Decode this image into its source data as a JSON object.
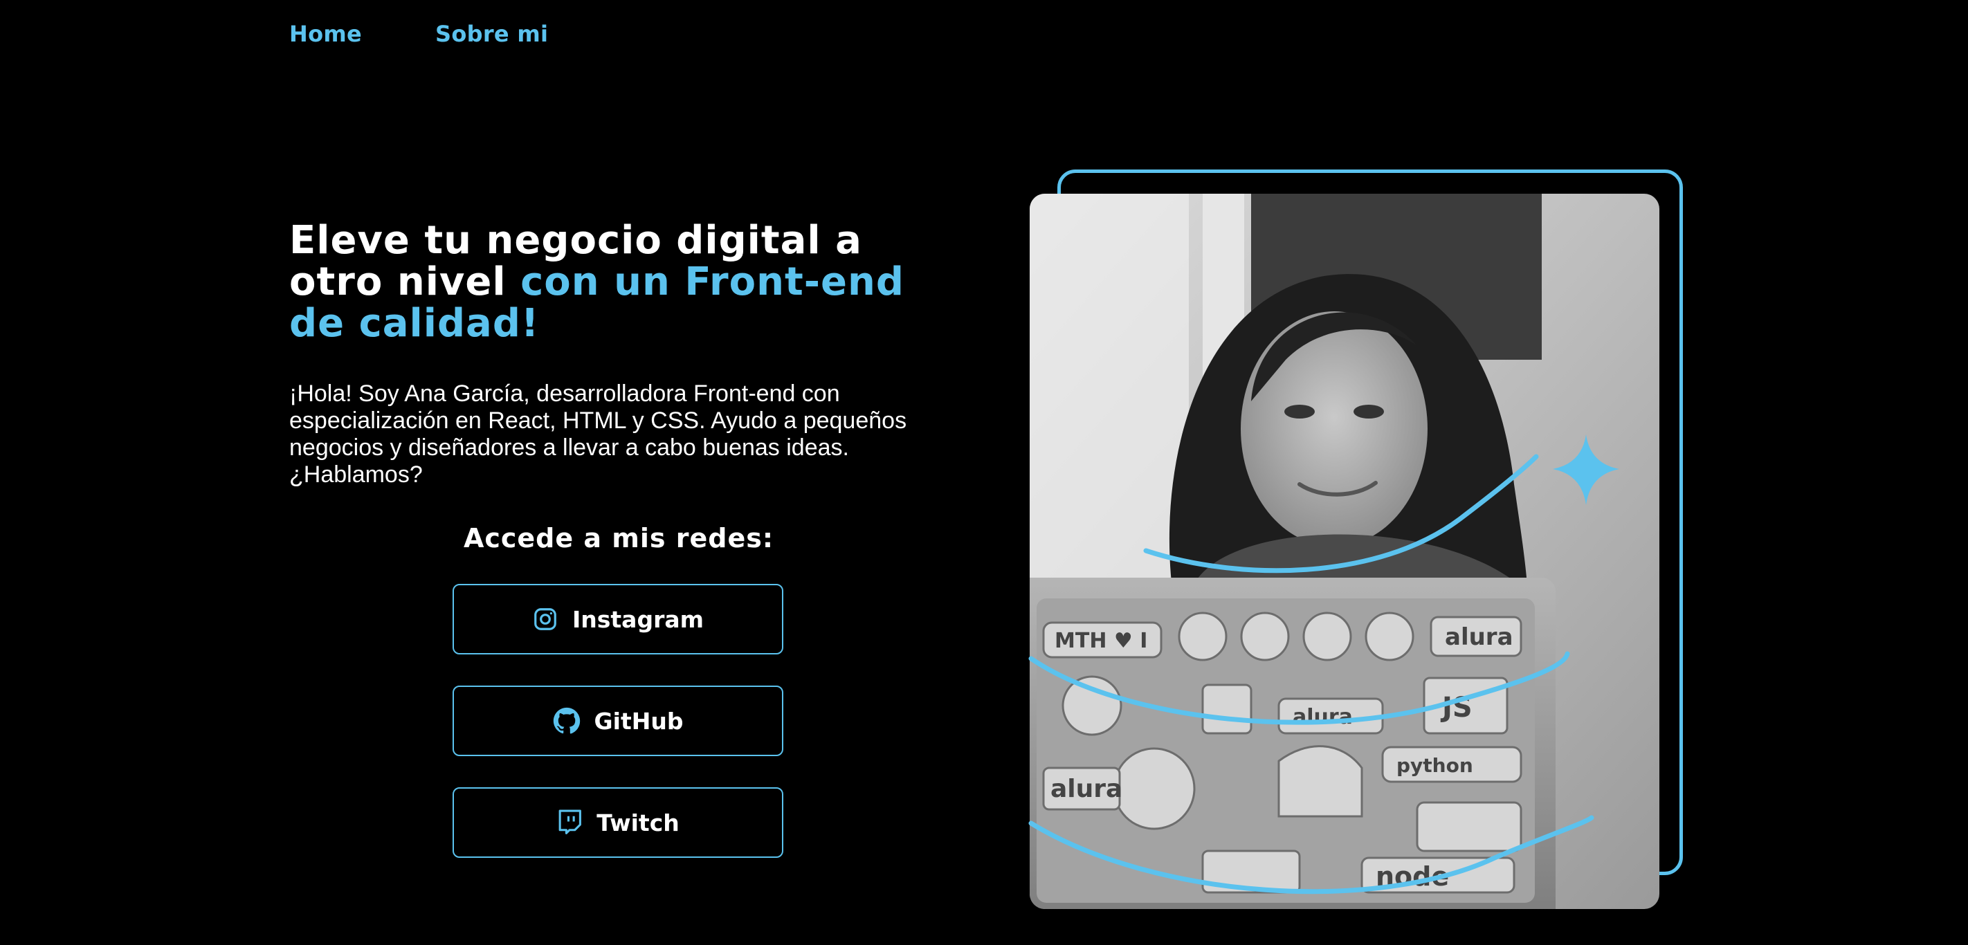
{
  "nav": {
    "home": "Home",
    "about": "Sobre mi"
  },
  "hero": {
    "headline_white": "Eleve tu negocio digital a otro nivel ",
    "headline_accent": "con un Front-end de calidad!",
    "intro": "¡Hola! Soy Ana García, desarrolladora Front-end con especialización en React, HTML y CSS. Ayudo a pequeños negocios y diseñadores a llevar a cabo buenas ideas. ¿Hablamos?"
  },
  "social": {
    "title": "Accede a mis redes:",
    "buttons": [
      {
        "label": "Instagram",
        "icon": "instagram-icon"
      },
      {
        "label": "GitHub",
        "icon": "github-icon"
      },
      {
        "label": "Twitch",
        "icon": "twitch-icon"
      }
    ]
  },
  "colors": {
    "accent": "#5bc2ee",
    "background": "#000000",
    "text": "#ffffff"
  }
}
